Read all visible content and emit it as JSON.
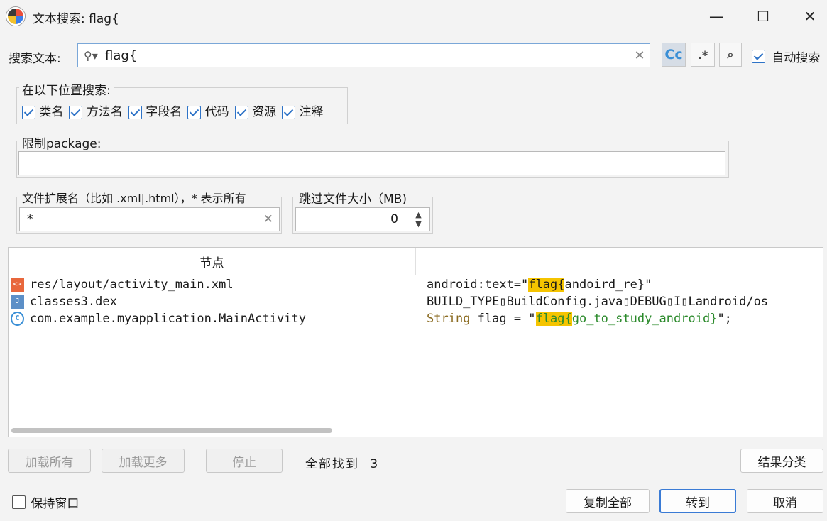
{
  "window": {
    "title": "文本搜索: flag{",
    "minimize": "—",
    "maximize": "☐",
    "close": "✕"
  },
  "search": {
    "label": "搜索文本:",
    "value": "flag{",
    "case_btn": "Cc",
    "regex_btn": ".*",
    "word_btn": "⌕",
    "auto_search_label": "自动搜索",
    "auto_search_checked": true
  },
  "scope": {
    "title": "在以下位置搜索:",
    "options": [
      {
        "label": "类名",
        "checked": true
      },
      {
        "label": "方法名",
        "checked": true
      },
      {
        "label": "字段名",
        "checked": true
      },
      {
        "label": "代码",
        "checked": true
      },
      {
        "label": "资源",
        "checked": true
      },
      {
        "label": "注释",
        "checked": true
      }
    ]
  },
  "package_limit": {
    "title": "限制package:",
    "value": ""
  },
  "file_ext": {
    "title": "文件扩展名（比如 .xml|.html），* 表示所有",
    "value": "*"
  },
  "skip_size": {
    "title": "跳过文件大小（MB)",
    "value": "0"
  },
  "results": {
    "col_node": "节点",
    "col_code": "",
    "rows": [
      {
        "node": "res/layout/activity_main.xml",
        "icon": "xml-resource-icon",
        "pre": "android:text=\"",
        "match": "flag{",
        "post": "andoird_re}\""
      },
      {
        "node": "classes3.dex",
        "icon": "dex-file-icon",
        "pre": "BUILD_TYPE▯BuildConfig.java▯DEBUG▯I▯Landroid/os",
        "match": "",
        "post": ""
      },
      {
        "node": "com.example.myapplication.MainActivity",
        "icon": "class-icon",
        "kw": "String",
        "mid": " flag = \"",
        "match": "flag{",
        "post": "go_to_study_android}",
        "tail": "\";"
      }
    ]
  },
  "footer": {
    "load_all": "加载所有",
    "load_more": "加载更多",
    "stop": "停止",
    "found_label": "全部找到",
    "found_count": "3",
    "group_results": "结果分类",
    "keep_window": "保持窗口",
    "copy_all": "复制全部",
    "goto": "转到",
    "cancel": "取消"
  }
}
